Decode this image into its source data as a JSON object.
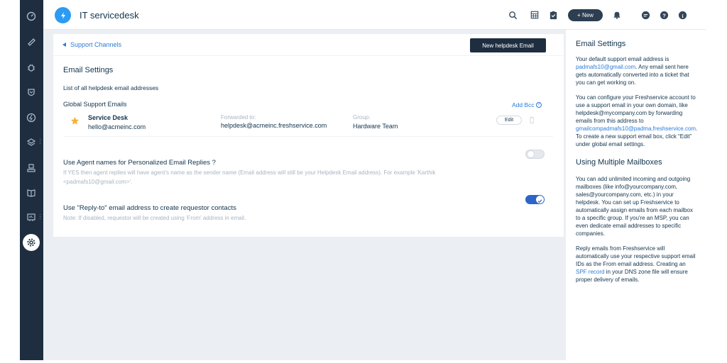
{
  "header": {
    "app_title": "IT servicedesk",
    "new_button_label": "+ New"
  },
  "card": {
    "breadcrumb": "Support Channels",
    "new_email_button": "New helpdesk Email",
    "title": "Email Settings",
    "subtitle": "List of all helpdesk email addresses",
    "global_label": "Global Support Emails",
    "add_bcc": "Add Bcc",
    "email_row": {
      "name": "Service Desk",
      "email": "hello@acmeinc.com",
      "forwarded_label": "Forwarded to:",
      "forwarded_value": "helpdesk@acmeinc.freshservice.com",
      "group_label": "Group:",
      "group_value": "Hardware Team",
      "edit_label": "Edit"
    },
    "options": [
      {
        "title": "Use Agent names for Personalized Email Replies ?",
        "help": "If YES then agent replies will have agent's name as the sender name (Email address will still be your Helpdesk Email address). For example 'Karthik <padmafs10@gmail.com>'.",
        "enabled": false
      },
      {
        "title": "Use \"Reply-to\" email address to create requestor contacts",
        "help": "Note: If disabled, requestor will be created using 'From' address in email.",
        "enabled": true
      }
    ]
  },
  "right_panel": {
    "title": "Email Settings",
    "p1_before": "Your default support email address is ",
    "p1_link": "padmafs10@gmail.com",
    "p1_after": ". Any email sent here gets automatically converted into a ticket that you can get working on.",
    "p2_before": "You can configure your Freshservice account to use a support email in your own domain, like helpdesk@mycompany.com by forwarding emails from this address to ",
    "p2_link": "gmailcompadmafs10@padma.freshservice.com",
    "p2_after": ". To create a new support email box, click “Edit” under global email settings.",
    "title2": "Using Multiple Mailboxes",
    "p3": "You can add unlimited incoming and outgoing mailboxes (like info@yourcompany.com, sales@yourcompany.com, etc.) in your helpdesk. You can set up Freshservice to automatically assign emails from each mailbox to a specific group. If you're an MSP, you can even dedicate email addresses to specific companies.",
    "p4_before": "Reply emails from Freshservice will automatically use your respective support email IDs as the From email address. Creating an ",
    "p4_link": "SPF record",
    "p4_after": " in your DNS zone file will ensure proper delivery of emails."
  },
  "icons": [
    "dashboard-icon",
    "tickets-icon",
    "problems-icon",
    "changes-icon",
    "releases-icon",
    "assets-icon",
    "inventory-icon",
    "solutions-icon",
    "reports-icon",
    "admin-gear-icon",
    "search-icon",
    "calendar-icon",
    "todo-icon",
    "bell-icon",
    "chat-icon",
    "help-icon",
    "info-icon"
  ],
  "colors": {
    "nav": "#1e2e40",
    "link": "#2c7cd8",
    "primary_btn": "#1e2e40",
    "toggle_on": "#2c64c8",
    "star": "#f5b335",
    "logo": "#2b9bf4"
  }
}
